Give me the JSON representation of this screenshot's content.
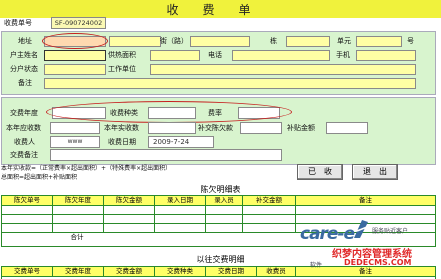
{
  "form": {
    "title": "收费单",
    "docno_label": "收费单号",
    "docno_value": "SF-090724002"
  },
  "owner": {
    "address_label": "地址",
    "street_label": "街（路）",
    "building_label": "栋",
    "unit_label": "单元",
    "room_label": "号",
    "name_label": "户主姓名",
    "heat_area_label": "供热面积",
    "phone_label": "电话",
    "mobile_label": "手机",
    "household_status_label": "分户状态",
    "work_unit_label": "工作单位",
    "remark_label": "备注"
  },
  "payment": {
    "year_label": "交费年度",
    "kind_label": "收费种类",
    "rate_label": "费率",
    "year_due_label": "本年应收数",
    "year_paid_label": "本年实收数",
    "arrears_label": "补交陈欠款",
    "surcharge_label": "补贴金额",
    "payee_label": "收费人",
    "payee_value": "www",
    "date_label": "收费日期",
    "date_value": "2009-7-24",
    "remark_label": "交费备注"
  },
  "notes": {
    "line1": "本年实收款=（正常费率×超出面积）+（特殊费率×超出面积）",
    "line2": "总面积=超出面积+补贴面积"
  },
  "buttons": {
    "received": "已　收",
    "exit": "退　出"
  },
  "arrears_table": {
    "title": "陈欠明细表",
    "headers": [
      "陈欠单号",
      "陈欠年度",
      "陈欠金额",
      "录入日期",
      "录入员",
      "补交金额",
      "备注"
    ],
    "total_label": "合计"
  },
  "history_table": {
    "title": "以往交费明细",
    "headers": [
      "交费单号",
      "交费年度",
      "交费金额",
      "交费种类",
      "交费日期",
      "收费员",
      "备注"
    ]
  },
  "logo": {
    "text": "care-e",
    "side_text": "服务贴近客户",
    "software_text": "软件"
  },
  "watermark": {
    "line1": "织梦内容管理系统",
    "line2": "DEDECMS.COM"
  }
}
